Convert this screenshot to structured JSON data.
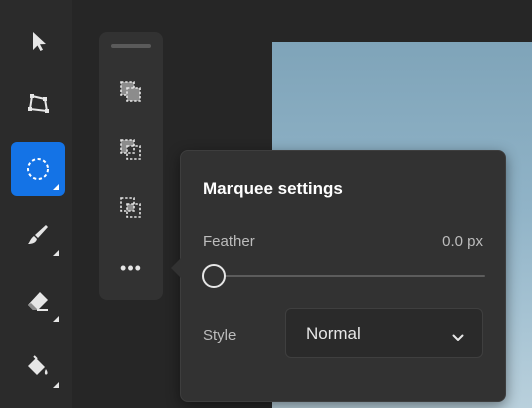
{
  "toolbar": {
    "tools": [
      {
        "name": "select-tool",
        "icon": "arrow-pointer-icon",
        "active": false
      },
      {
        "name": "transform-tool",
        "icon": "transform-quad-icon",
        "active": false
      },
      {
        "name": "marquee-tool",
        "icon": "ellipse-marquee-icon",
        "active": true
      },
      {
        "name": "brush-tool",
        "icon": "brush-icon",
        "active": false
      },
      {
        "name": "eraser-tool",
        "icon": "eraser-icon",
        "active": false
      },
      {
        "name": "fill-tool",
        "icon": "paint-bucket-icon",
        "active": false
      }
    ],
    "active_color": "#1473e6"
  },
  "selection_modes": {
    "buttons": [
      {
        "icon": "selection-add-icon"
      },
      {
        "icon": "selection-subtract-icon"
      },
      {
        "icon": "selection-intersect-icon"
      }
    ],
    "more_label": "•••"
  },
  "marquee_settings": {
    "title": "Marquee settings",
    "feather": {
      "label": "Feather",
      "value_text": "0.0 px",
      "value": 0.0
    },
    "style": {
      "label": "Style",
      "selected": "Normal"
    }
  }
}
